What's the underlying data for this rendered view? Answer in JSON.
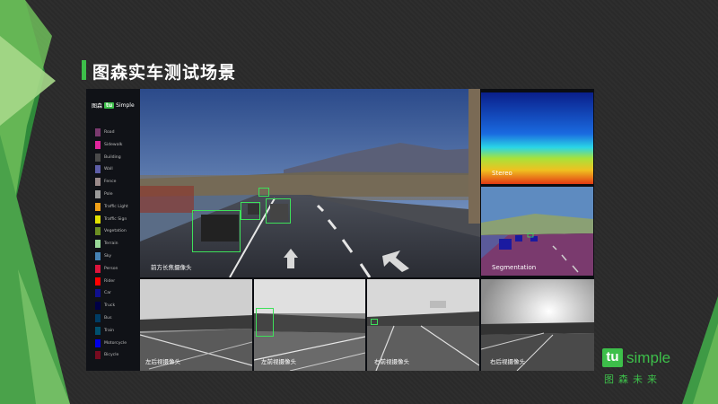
{
  "slide": {
    "title": "图森实车测试场景",
    "accent_color": "#3dbf4a"
  },
  "legend": {
    "logo_cn": "图森",
    "logo_tu": "tu",
    "logo_simple": "Simple",
    "items": [
      {
        "label": "Road",
        "color": "#7a3a6e"
      },
      {
        "label": "Sidewalk",
        "color": "#e0259c"
      },
      {
        "label": "Building",
        "color": "#4a4a4a"
      },
      {
        "label": "Wall",
        "color": "#5e5ea8"
      },
      {
        "label": "Fence",
        "color": "#9a8a8a"
      },
      {
        "label": "Pole",
        "color": "#9a9a9a"
      },
      {
        "label": "Traffic Light",
        "color": "#f0a018"
      },
      {
        "label": "Traffic Sign",
        "color": "#e0e000"
      },
      {
        "label": "Vegetation",
        "color": "#6b8e23"
      },
      {
        "label": "Terrain",
        "color": "#98d898"
      },
      {
        "label": "Sky",
        "color": "#4682b4"
      },
      {
        "label": "Person",
        "color": "#dc143c"
      },
      {
        "label": "Rider",
        "color": "#ff0000"
      },
      {
        "label": "Car",
        "color": "#10108e"
      },
      {
        "label": "Truck",
        "color": "#000046"
      },
      {
        "label": "Bus",
        "color": "#003c64"
      },
      {
        "label": "Train",
        "color": "#00506e"
      },
      {
        "label": "Motorcycle",
        "color": "#0000e6"
      },
      {
        "label": "Bicycle",
        "color": "#770b20"
      }
    ]
  },
  "cameras": {
    "main_label": "前方长焦摄像头",
    "stereo_label": "Stereo",
    "segmentation_label": "Segmentation",
    "bottom": [
      {
        "label": "左后视摄像头"
      },
      {
        "label": "左前视摄像头"
      },
      {
        "label": "右前视摄像头"
      },
      {
        "label": "右后视摄像头"
      }
    ]
  },
  "brand": {
    "tu": "tu",
    "simple": "simple",
    "cn": "图森未来"
  }
}
